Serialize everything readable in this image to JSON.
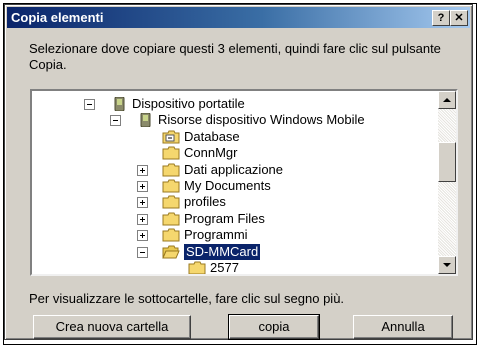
{
  "window": {
    "title": "Copia elementi",
    "help_glyph": "?",
    "close_glyph": "✕"
  },
  "instruction": "Selezionare dove copiare questi 3 elementi, quindi fare clic sul pulsante Copia.",
  "tree": {
    "items": [
      {
        "label": "Dispositivo portatile",
        "expander": "minus",
        "icon": "device-icon",
        "level": 0
      },
      {
        "label": "Risorse dispositivo Windows Mobile",
        "expander": "minus",
        "icon": "device-icon",
        "level": 1
      },
      {
        "label": "Database",
        "expander": "none",
        "icon": "database-folder-icon",
        "level": 2
      },
      {
        "label": "ConnMgr",
        "expander": "none",
        "icon": "folder-icon",
        "level": 2
      },
      {
        "label": "Dati applicazione",
        "expander": "plus",
        "icon": "folder-icon",
        "level": 2
      },
      {
        "label": "My Documents",
        "expander": "plus",
        "icon": "folder-icon",
        "level": 2
      },
      {
        "label": "profiles",
        "expander": "plus",
        "icon": "folder-icon",
        "level": 2
      },
      {
        "label": "Program Files",
        "expander": "plus",
        "icon": "folder-icon",
        "level": 2
      },
      {
        "label": "Programmi",
        "expander": "plus",
        "icon": "folder-icon",
        "level": 2
      },
      {
        "label": "SD-MMCard",
        "expander": "minus",
        "icon": "open-folder-icon",
        "level": 2,
        "selected": true
      },
      {
        "label": "2577",
        "expander": "none",
        "icon": "folder-icon",
        "level": 3
      }
    ]
  },
  "hint": "Per visualizzare le sottocartelle, fare clic sul segno più.",
  "buttons": {
    "new_folder": "Crea nuova cartella",
    "copy": "copia",
    "cancel": "Annulla"
  },
  "colors": {
    "title_bar": "#0a246a",
    "selection": "#0a246a",
    "face": "#d4d0c8",
    "folder": "#f5d76e"
  }
}
